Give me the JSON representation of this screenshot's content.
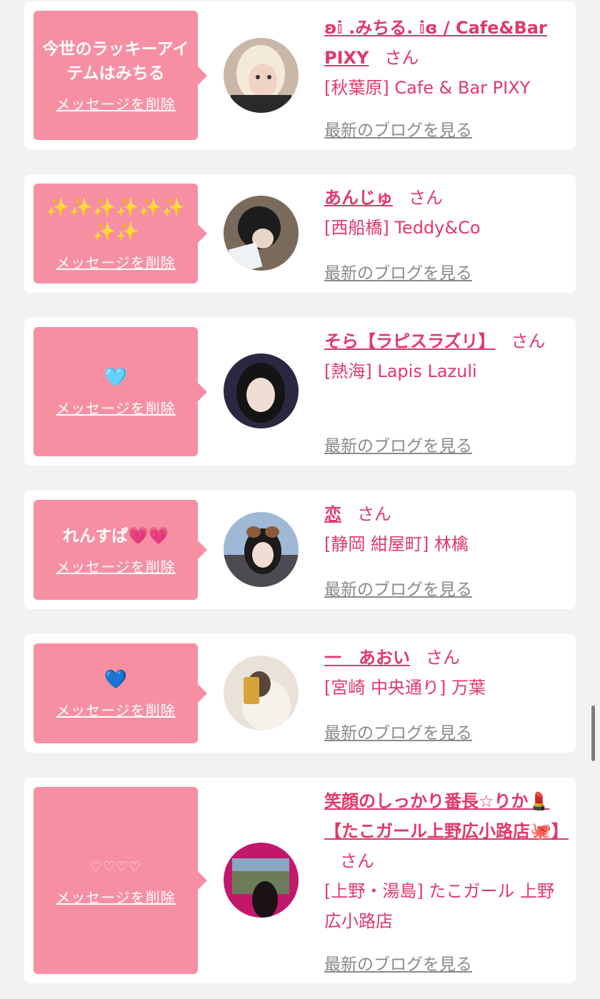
{
  "cards": [
    {
      "message": "今世のラッキーアイテムはみちる",
      "delete_label": "メッセージを削除",
      "name": "ʚ𝕚 .みちる. 𝕚ɞ / Cafe&Bar PIXY",
      "san": "さん",
      "shop": "[秋葉原] Cafe & Bar PIXY",
      "blog_label": "最新のブログを見る"
    },
    {
      "message": "✨✨✨✨✨✨✨✨",
      "delete_label": "メッセージを削除",
      "name": "あんじゅ",
      "san": "さん",
      "shop": "[西船橋] Teddy&Co",
      "blog_label": "最新のブログを見る"
    },
    {
      "message": "🩵",
      "delete_label": "メッセージを削除",
      "name": "そら【ラピスラズリ】",
      "san": "さん",
      "shop": "[熱海] Lapis Lazuli",
      "blog_label": "最新のブログを見る"
    },
    {
      "message": "れんすぱ💗💗",
      "delete_label": "メッセージを削除",
      "name": "恋",
      "san": "さん",
      "shop": "[静岡 紺屋町] 林檎",
      "blog_label": "最新のブログを見る"
    },
    {
      "message": "💙",
      "delete_label": "メッセージを削除",
      "name": "一　あおい",
      "san": "さん",
      "shop": "[宮崎 中央通り] 万葉",
      "blog_label": "最新のブログを見る"
    },
    {
      "message": "♡♡♡♡",
      "delete_label": "メッセージを削除",
      "name": "笑顔のしっかり番長☆りか💄【たこガール上野広小路店🐙】",
      "san": "さん",
      "shop": "[上野・湯島] たこガール 上野広小路店",
      "blog_label": "最新のブログを見る"
    }
  ],
  "colors": {
    "bubble": "#f78fa3",
    "accent": "#e0386a",
    "link_gray": "#8a8a8a",
    "background": "#f2f2f2"
  }
}
